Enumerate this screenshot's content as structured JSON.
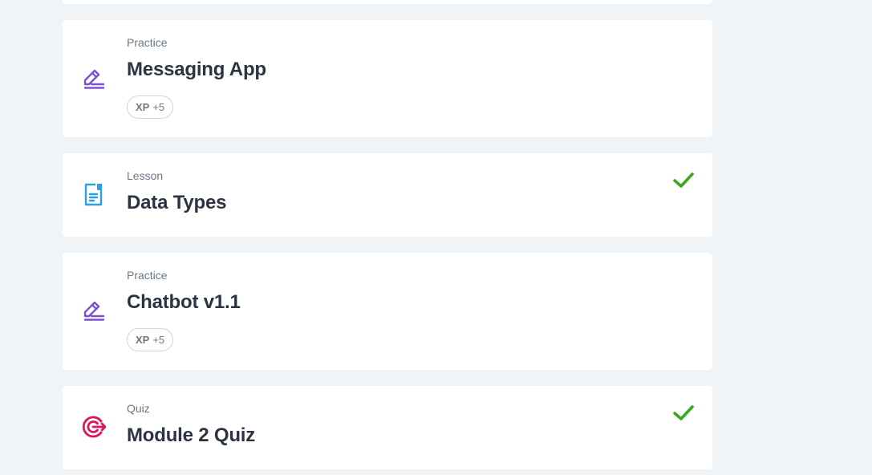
{
  "items": [
    {
      "kind": "Practice",
      "title": "Messaging App",
      "xp_label": "XP",
      "xp_value": "+5",
      "completed": false,
      "icon": "pencil-icon"
    },
    {
      "kind": "Lesson",
      "title": "Data Types",
      "completed": true,
      "icon": "document-icon"
    },
    {
      "kind": "Practice",
      "title": "Chatbot v1.1",
      "xp_label": "XP",
      "xp_value": "+5",
      "completed": false,
      "icon": "pencil-icon"
    },
    {
      "kind": "Quiz",
      "title": "Module 2 Quiz",
      "completed": true,
      "icon": "target-icon"
    }
  ],
  "colors": {
    "practice": "#7e4fd6",
    "lesson": "#2a9fe3",
    "quiz": "#e0135c",
    "check": "#3aaa1a",
    "background": "#f1f4f7"
  }
}
